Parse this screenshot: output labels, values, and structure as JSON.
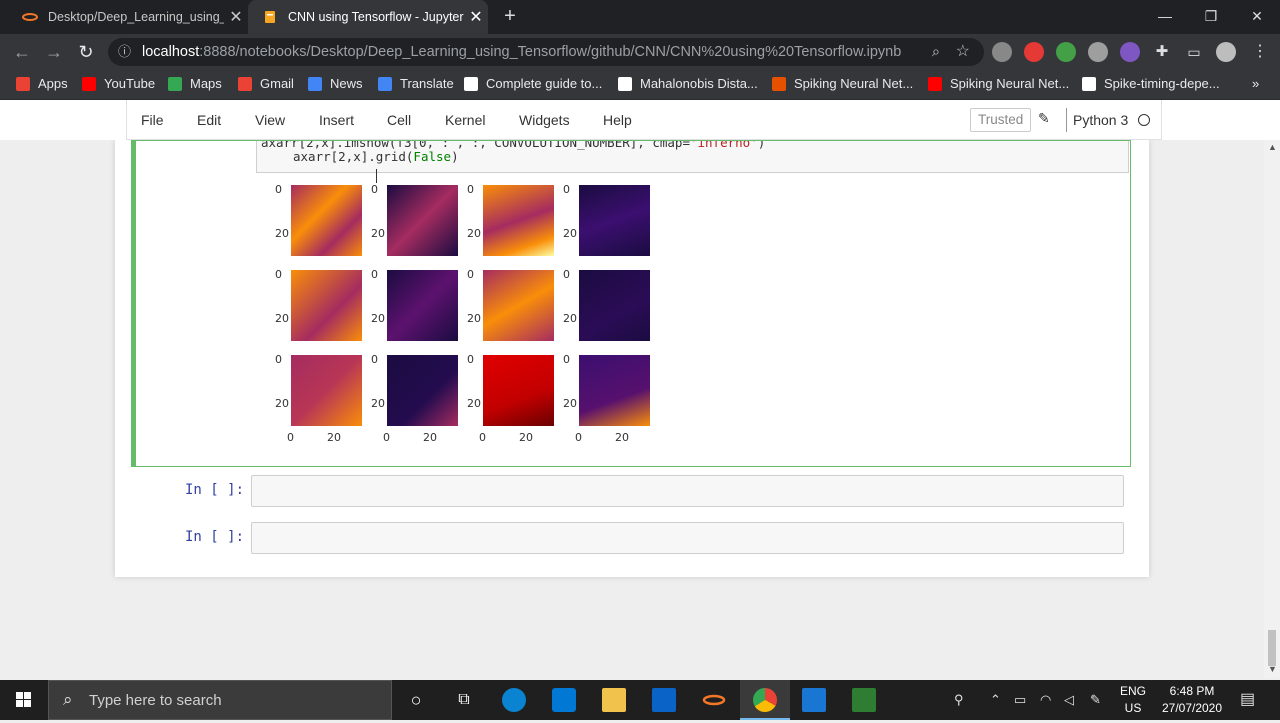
{
  "browser": {
    "tabs": [
      {
        "title": "Desktop/Deep_Learning_using_Te",
        "active": false
      },
      {
        "title": "CNN using Tensorflow - Jupyter N",
        "active": true
      }
    ],
    "url": {
      "host": "localhost",
      "path": ":8888/notebooks/Desktop/Deep_Learning_using_Tensorflow/github/CNN/CNN%20using%20Tensorflow.ipynb"
    },
    "bookmarks": [
      {
        "label": "Apps",
        "color": "#ea4335"
      },
      {
        "label": "YouTube",
        "color": "#ff0000"
      },
      {
        "label": "Maps",
        "color": "#34a853"
      },
      {
        "label": "Gmail",
        "color": "#ea4335"
      },
      {
        "label": "News",
        "color": "#4285f4"
      },
      {
        "label": "Translate",
        "color": "#4285f4"
      },
      {
        "label": "Complete guide to...",
        "color": "#ffffff"
      },
      {
        "label": "Mahalonobis Dista...",
        "color": "#ffffff"
      },
      {
        "label": "Spiking Neural Net...",
        "color": "#e65100"
      },
      {
        "label": "Spiking Neural Net...",
        "color": "#ff0000"
      },
      {
        "label": "Spike-timing-depe...",
        "color": "#ffffff"
      }
    ],
    "more_bookmarks": "»"
  },
  "jupyter": {
    "menu": [
      "File",
      "Edit",
      "View",
      "Insert",
      "Cell",
      "Kernel",
      "Widgets",
      "Help"
    ],
    "trusted": "Trusted",
    "kernel": "Python 3"
  },
  "cell": {
    "code_line1_prefix": "axarr[2,x].imshow(f3[0,",
    "code_line1_mid": " : , :, CONVOLUTION_NUMBER], cmap=",
    "code_line1_str": "'inferno'",
    "code_line1_end": ")",
    "code_line2_prefix": "axarr[2,x].grid(",
    "code_line2_kw": "False",
    "code_line2_end": ")"
  },
  "plot": {
    "y_ticks": [
      "0",
      "20"
    ],
    "x_ticks": [
      "0",
      "20"
    ],
    "colors": {
      "inferno_dark": "#1b0c41",
      "inferno_mid": "#a52c60",
      "inferno_bright": "#f98e09",
      "inferno_top": "#fcffa4"
    }
  },
  "empty_cells": [
    {
      "prompt": "In [ ]:"
    },
    {
      "prompt": "In [ ]:"
    }
  ],
  "taskbar": {
    "search_placeholder": "Type here to search",
    "lang_top": "ENG",
    "lang_bottom": "US",
    "time": "6:48 PM",
    "date": "27/07/2020"
  }
}
